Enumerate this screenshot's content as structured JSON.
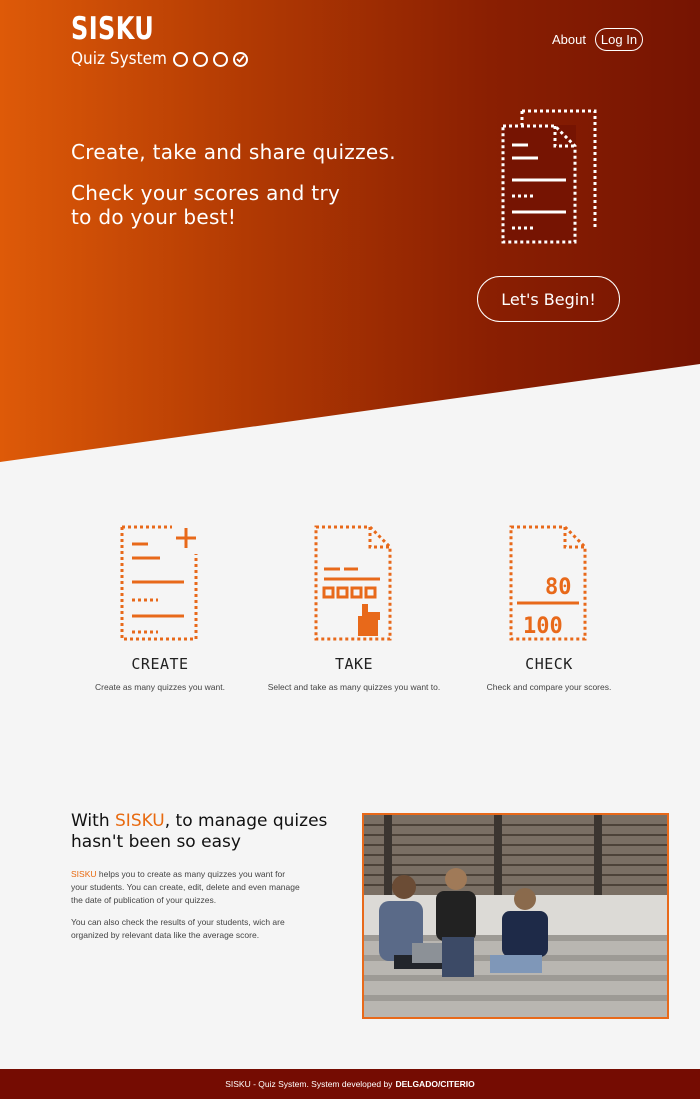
{
  "header": {
    "brand_title": "SISKU",
    "brand_subtitle": "Quiz System",
    "nav_about": "About",
    "nav_login": "Log In"
  },
  "hero": {
    "line1": "Create, take and share quizzes.",
    "line2": "Check your scores and try to do your best!",
    "cta": "Let's Begin!"
  },
  "features": [
    {
      "title": "CREATE",
      "desc": "Create as many quizzes you want.",
      "icon": "create-quiz-icon"
    },
    {
      "title": "TAKE",
      "desc": "Select and take as many quizzes you want to.",
      "icon": "take-quiz-icon"
    },
    {
      "title": "CHECK",
      "desc": "Check and compare your scores.",
      "icon": "check-score-icon",
      "score_top": "80",
      "score_bottom": "100"
    }
  ],
  "about": {
    "title_prefix": "With ",
    "title_brand": "SISKU",
    "title_suffix": ", to manage quizes hasn't been so easy",
    "p1_brand": "SISKU",
    "p1_text": " helps you to create as many quizzes you want for your students. You can create, edit, delete and even manage the date of publication of your quizzes.",
    "p2": "You can also check the results of your students, wich are organized by relevant data like the average score."
  },
  "footer": {
    "text": "SISKU - Quiz System. System developed by",
    "credit": "DELGADO/CITERIO"
  },
  "colors": {
    "accent": "#e86a10",
    "hero_start": "#de5a08",
    "hero_end": "#761402",
    "footer_bg": "#750c02"
  }
}
